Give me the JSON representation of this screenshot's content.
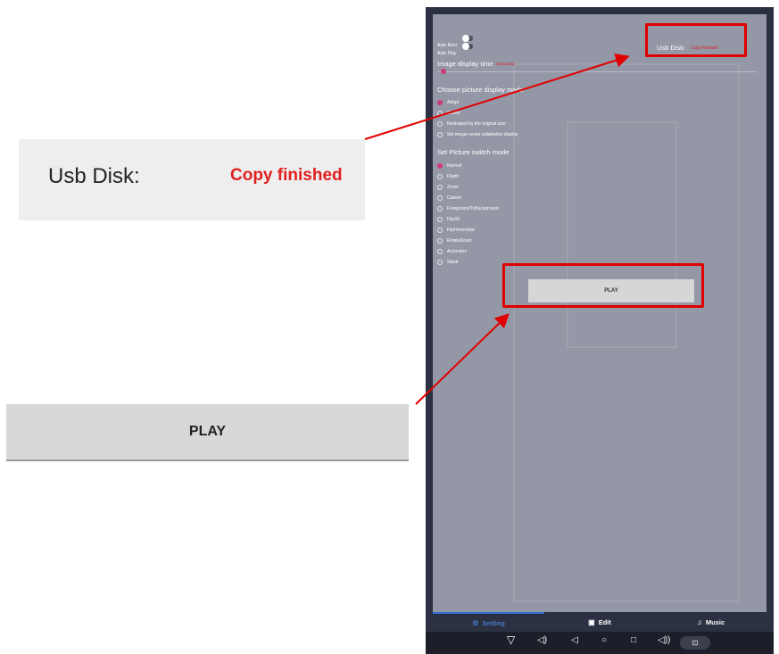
{
  "zoom": {
    "usb_label": "Usb Disk:",
    "usb_status": "Copy finished",
    "play_label": "PLAY"
  },
  "device": {
    "toggles": [
      {
        "label": "Auto Boot",
        "on": true
      },
      {
        "label": "Auto Play",
        "on": true
      }
    ],
    "usb_label": "Usb Disk:",
    "usb_status": "Copy finished",
    "image_display_time": {
      "label": "Image display time",
      "hint": "[Seconds]"
    },
    "display_mode": {
      "title": "Choose picture display mode",
      "options": [
        "Adapt",
        "Center",
        "Reshaped by the original size",
        "Set image center adaptation display"
      ],
      "selected": 0
    },
    "switch_mode": {
      "title": "Set Picture switch mode",
      "options": [
        "Normal",
        "Depth",
        "Zoom",
        "Cubein",
        "ForegroundToBackground",
        "Flip3D",
        "FlipHorizontal",
        "RotateDown",
        "Accordion",
        "Stack"
      ],
      "selected": 0
    },
    "play_label": "PLAY",
    "tabs": [
      {
        "label": "Setting",
        "icon": "gear-icon",
        "active": true
      },
      {
        "label": "Edit",
        "icon": "image-icon",
        "active": false
      },
      {
        "label": "Music",
        "icon": "music-icon",
        "active": false
      }
    ],
    "nav_icons": [
      "menu-down-icon",
      "volume-down-icon",
      "back-icon",
      "home-icon",
      "recents-icon",
      "volume-up-icon",
      "screenshot-icon"
    ]
  },
  "colors": {
    "highlight": "#e00000",
    "status_text": "#e02020",
    "accent": "#d0397a",
    "tab_active": "#2f72d1"
  }
}
